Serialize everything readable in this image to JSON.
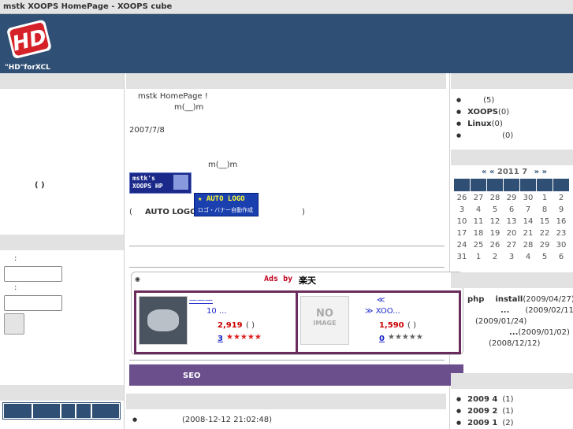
{
  "window": {
    "title": "mstk  XOOPS HomePage - XOOPS cube"
  },
  "header": {
    "logo_text": "\"HD\"forXCL",
    "logo_mark": "HD"
  },
  "left": {
    "center_text": "(      )",
    "login_label1": ":",
    "login_label2": ":"
  },
  "main": {
    "line1": "mstk HomePage !",
    "line2": "m(__)m",
    "date": "2007/7/8",
    "line3": "m(__)m",
    "banner1_top": "mstk's",
    "banner1_bottom": "XOOPS HP",
    "auto_logo_pre": "(",
    "auto_logo_label": "AUTO LOGO",
    "auto_logo_post": ")",
    "autologo_top": "★ AUTO LOGO",
    "autologo_bottom": "ロゴ・バナー自動作成",
    "ads_header": "Ads by",
    "ads_brand": "楽天",
    "ad1": {
      "link1": "———",
      "link2": "10 ...",
      "price": "2,919",
      "paren": "( )",
      "count": "3",
      "stars": "★★★★★"
    },
    "ad2": {
      "image_text_1": "NO",
      "image_text_2": "IMAGE",
      "link1": "≪",
      "link2": "≫ XOO...",
      "price": "1,590",
      "paren": "( )",
      "count": "0",
      "stars": "★★★★★"
    },
    "seo_label": "SEO",
    "bottom_item": "(2008-12-12 21:02:48)"
  },
  "right": {
    "categories": [
      {
        "name": "",
        "count": "(5)"
      },
      {
        "name": "XOOPS",
        "count": "(0)"
      },
      {
        "name": "Linux",
        "count": "(0)"
      },
      {
        "name": "",
        "count": "(0)"
      }
    ],
    "calendar": {
      "nav_prev": "« «",
      "title": "2011 7",
      "nav_next": "» »",
      "rows": [
        [
          "26",
          "27",
          "28",
          "29",
          "30",
          "1",
          "2"
        ],
        [
          "3",
          "4",
          "5",
          "6",
          "7",
          "8",
          "9"
        ],
        [
          "10",
          "11",
          "12",
          "13",
          "14",
          "15",
          "16"
        ],
        [
          "17",
          "18",
          "19",
          "20",
          "21",
          "22",
          "23"
        ],
        [
          "24",
          "25",
          "26",
          "27",
          "28",
          "29",
          "30"
        ],
        [
          "31",
          "1",
          "2",
          "3",
          "4",
          "5",
          "6"
        ]
      ]
    },
    "recent": [
      {
        "a": "php",
        "b": "install",
        "c": "(2009/04/27)"
      },
      {
        "a": "...",
        "c": "(2009/02/11)"
      },
      {
        "c": "(2009/01/24)"
      },
      {
        "a": "...",
        "c": "(2009/01/02)"
      },
      {
        "c": "(2008/12/12)"
      }
    ],
    "archives": [
      {
        "label": "2009 4",
        "count": "(1)"
      },
      {
        "label": "2009 2",
        "count": "(1)"
      },
      {
        "label": "2009 1",
        "count": "(2)"
      }
    ]
  }
}
